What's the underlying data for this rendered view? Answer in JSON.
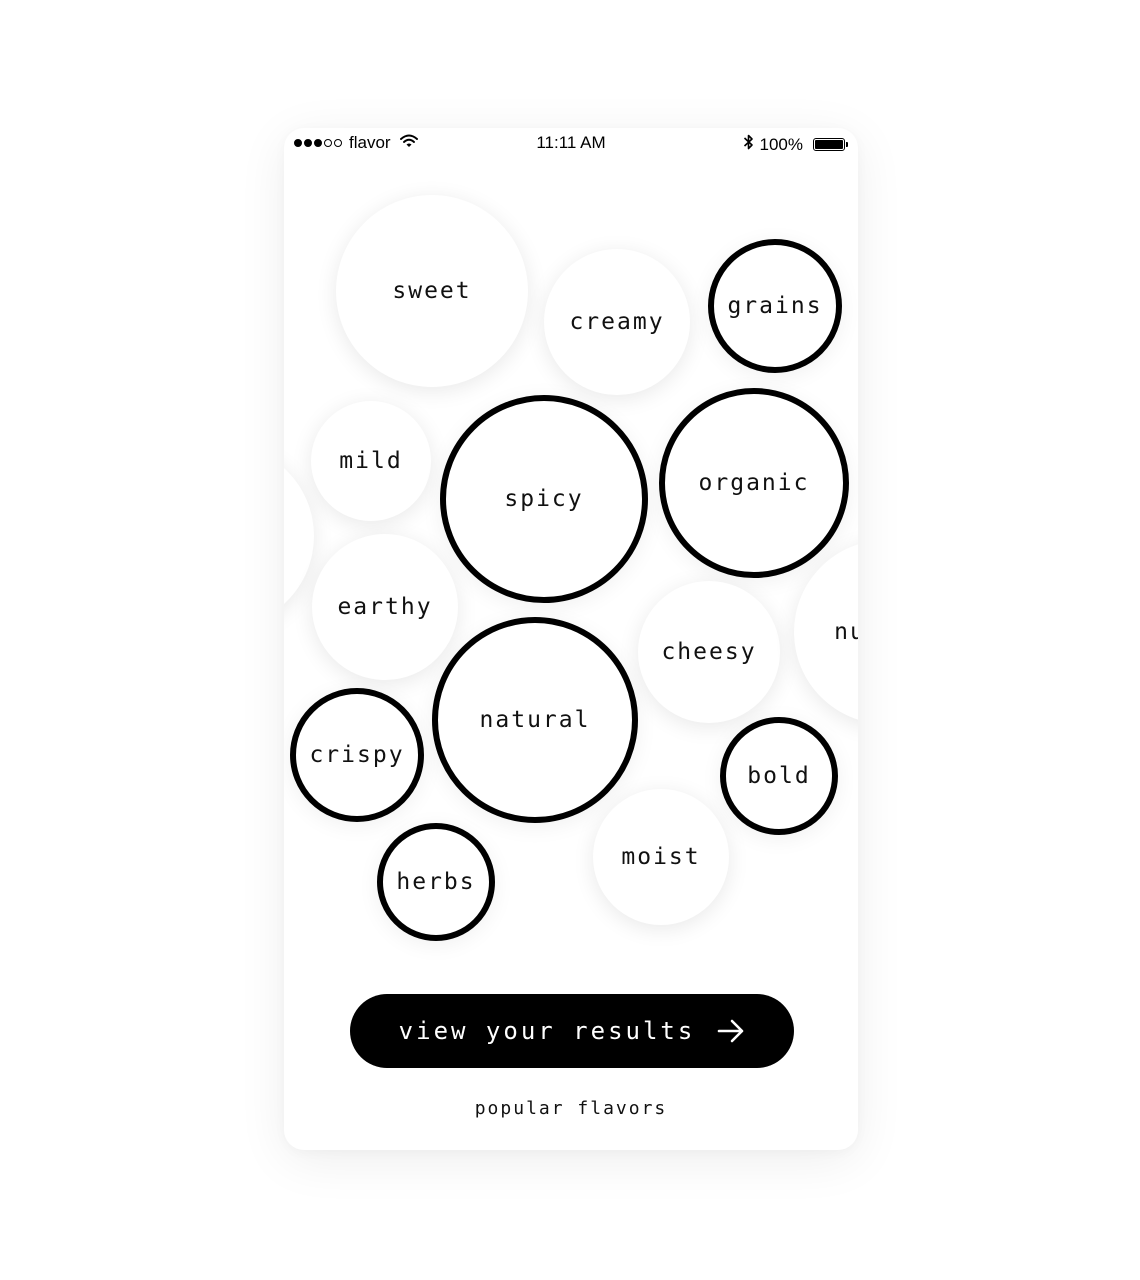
{
  "status_bar": {
    "signal_bars_filled": 3,
    "signal_bars_total": 5,
    "carrier": "flavor",
    "time": "11:11 AM",
    "battery_percent_label": "100%",
    "battery_level": 1.0,
    "icons": [
      "wifi-icon",
      "bluetooth-icon",
      "battery-icon"
    ]
  },
  "flavors": [
    {
      "label": "sweet",
      "selected": false
    },
    {
      "label": "creamy",
      "selected": false
    },
    {
      "label": "grains",
      "selected": true
    },
    {
      "label": "mild",
      "selected": false
    },
    {
      "label": "spicy",
      "selected": true
    },
    {
      "label": "organic",
      "selected": true
    },
    {
      "label": "",
      "selected": false
    },
    {
      "label": "earthy",
      "selected": false
    },
    {
      "label": "cheesy",
      "selected": false
    },
    {
      "label": "nu",
      "selected": false
    },
    {
      "label": "natural",
      "selected": true
    },
    {
      "label": "crispy",
      "selected": true
    },
    {
      "label": "bold",
      "selected": true
    },
    {
      "label": "moist",
      "selected": false
    },
    {
      "label": "herbs",
      "selected": true
    }
  ],
  "cta": {
    "label": "view your results",
    "icon": "arrow-right-icon"
  },
  "footer": {
    "link_label": "popular flavors"
  },
  "colors": {
    "accent": "#000000",
    "background": "#ffffff",
    "text": "#111111"
  }
}
